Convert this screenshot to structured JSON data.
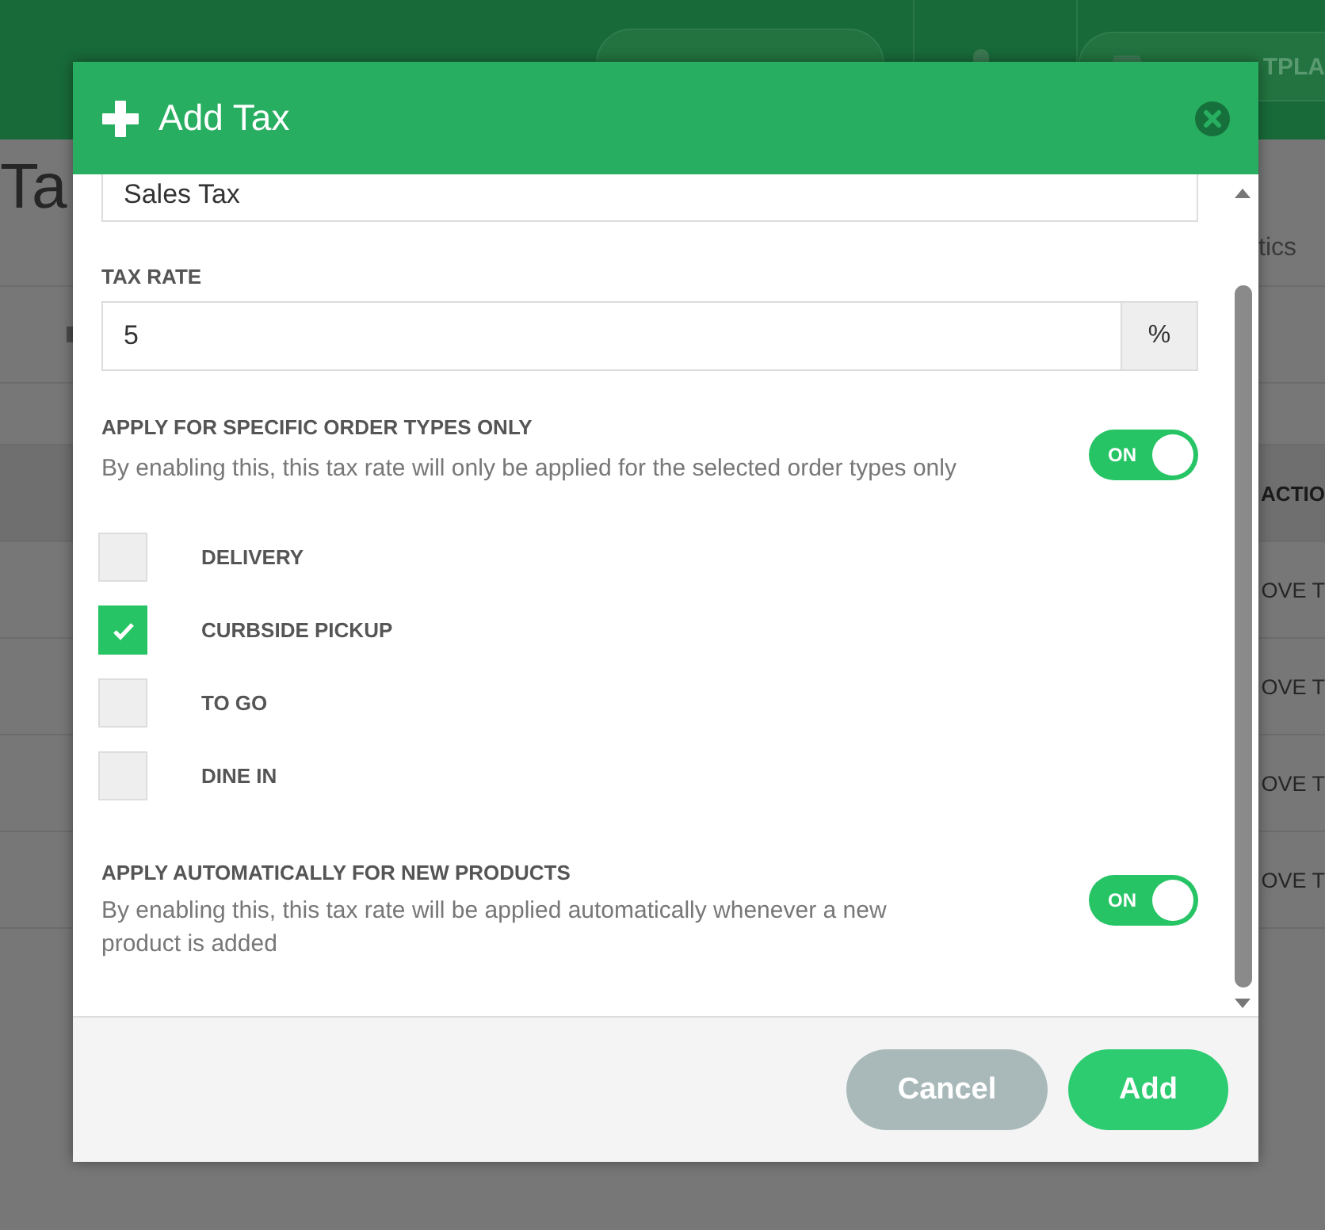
{
  "page": {
    "header_buttons": [
      {
        "kind": "plain"
      },
      {
        "label": "TPLA",
        "kind": "store"
      }
    ],
    "title": "Ta",
    "subtitle": "tics",
    "table": {
      "column_header": "ACTIO",
      "rows": [
        "OVE T",
        "OVE T",
        "OVE T",
        "OVE T"
      ]
    }
  },
  "dialog": {
    "title": "Add Tax",
    "name_value": "Sales Tax",
    "rate_label": "TAX RATE",
    "rate_value": "5",
    "rate_suffix": "%",
    "order_types_setting": {
      "label": "APPLY FOR SPECIFIC ORDER TYPES ONLY",
      "description": "By enabling this, this tax rate will only be applied for the selected order types only",
      "on": true,
      "state_label": "ON"
    },
    "order_types": [
      {
        "label": "DELIVERY",
        "checked": false
      },
      {
        "label": "CURBSIDE PICKUP",
        "checked": true
      },
      {
        "label": "TO GO",
        "checked": false
      },
      {
        "label": "DINE IN",
        "checked": false
      }
    ],
    "auto_apply_setting": {
      "label": "APPLY AUTOMATICALLY FOR NEW PRODUCTS",
      "description": "By enabling this, this tax rate will be applied automatically whenever a new product is added",
      "on": true,
      "state_label": "ON"
    },
    "buttons": [
      {
        "label": "Cancel",
        "kind": "secondary"
      },
      {
        "label": "Add",
        "kind": "primary"
      }
    ]
  }
}
